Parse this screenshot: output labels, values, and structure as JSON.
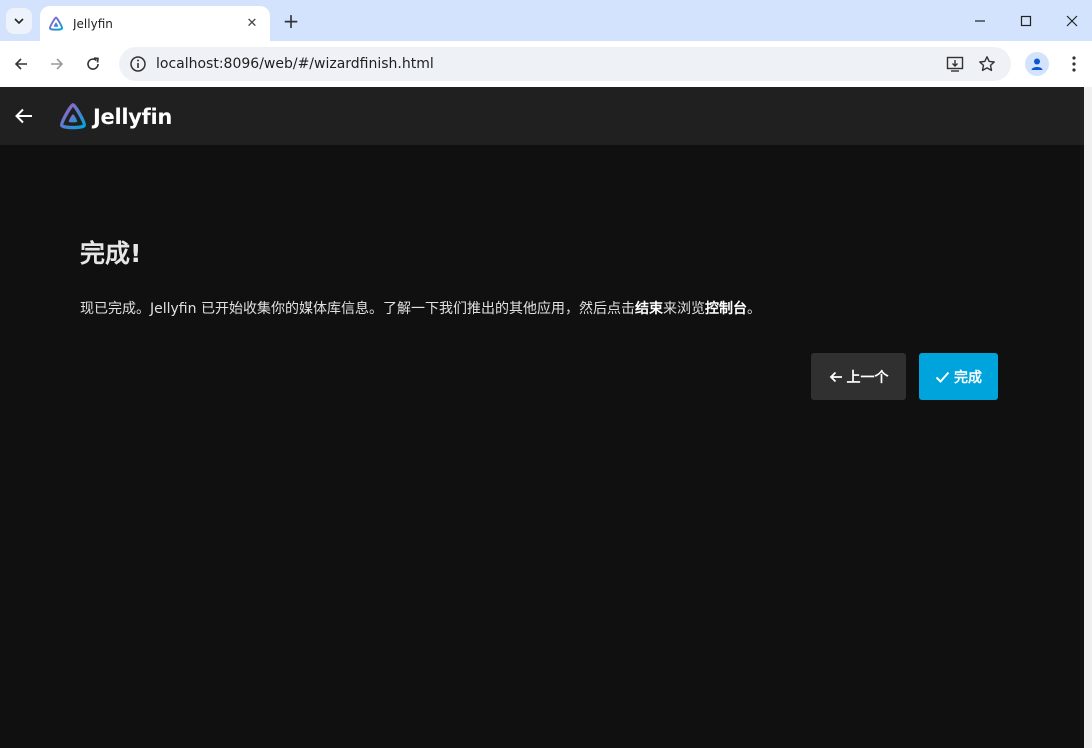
{
  "browser": {
    "tab_title": "Jellyfin",
    "tab_close_glyph": "✕",
    "new_tab_glyph": "+",
    "url": "localhost:8096/web/#/wizardfinish.html",
    "icons": [
      "tab-search-icon",
      "jellyfin-favicon-icon",
      "close-icon",
      "new-tab-icon",
      "minimize-icon",
      "maximize-icon",
      "window-close-icon",
      "back-arrow-icon",
      "forward-arrow-icon",
      "reload-icon",
      "site-info-icon",
      "install-app-icon",
      "bookmark-star-icon",
      "profile-icon",
      "more-menu-icon"
    ]
  },
  "app": {
    "logo_text": "Jellyfin",
    "brand_accent": "#00a4dc",
    "logo_gradient": [
      "#aa5cc3",
      "#00a4dc"
    ]
  },
  "wizard": {
    "title": "完成!",
    "description_before": "现已完成。Jellyfin 已开始收集你的媒体库信息。了解一下我们推出的其他应用，然后点击",
    "description_bold1": "结束",
    "description_mid": "来浏览",
    "description_bold2": "控制台",
    "description_after": "。",
    "prev_label": "上一个",
    "finish_label": "完成"
  }
}
